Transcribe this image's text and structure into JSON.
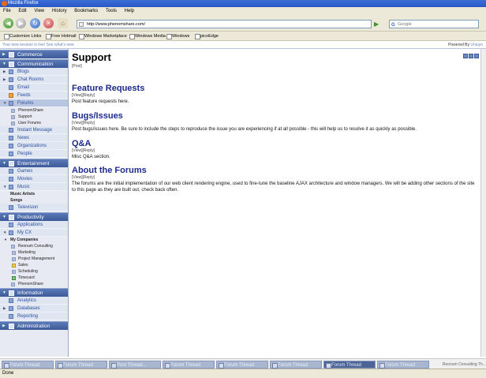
{
  "window": {
    "title": "Mozilla Firefox"
  },
  "menu": [
    "File",
    "Edit",
    "View",
    "History",
    "Bookmarks",
    "Tools",
    "Help"
  ],
  "nav": {
    "url": "http://www.phenomshare.com/",
    "search_placeholder": "Google"
  },
  "bookmarks": [
    "Customize Links",
    "Free Hotmail",
    "Windows Marketplace",
    "Windows Media",
    "Windows",
    "picoEdge"
  ],
  "infostrip": {
    "left": "Your new session is live! See what's new",
    "right": "Powered By",
    "right_logo": "Uniuyo"
  },
  "sidebar": {
    "commerce": "Commerce",
    "communication": "Communication",
    "comm_items": [
      "Blogs",
      "Chat Rooms",
      "Email",
      "Feeds",
      "Forums"
    ],
    "forum_subs": [
      "PhenomShare",
      "Support",
      "User Forums"
    ],
    "comm_items2": [
      "Instant Message",
      "News",
      "Organizations",
      "People"
    ],
    "entertainment": "Entertainment",
    "ent_items": [
      "Games",
      "Movies",
      "Music"
    ],
    "music_subs": [
      "Music Artists",
      "Songs"
    ],
    "television": "Television",
    "productivity": "Productivity",
    "prod_items": [
      "Applications",
      "My CX"
    ],
    "mycompanies": "My Companies",
    "company": "Reonum Consulting",
    "company_subs": [
      "Marketing",
      "Project Management",
      "Sales",
      "Scheduling",
      "Timecard"
    ],
    "phenom": "PhenomShare",
    "information": "Information",
    "info_items": [
      "Analytics",
      "Databases",
      "Reporting"
    ],
    "administration": "Administration"
  },
  "main": {
    "title": "Support",
    "post_link": "[Post]",
    "forums": [
      {
        "title": "Feature Requests",
        "actions": "[View][Reply]",
        "desc": "Post feature requests here."
      },
      {
        "title": "Bugs/Issues",
        "actions": "[View][Reply]",
        "desc": "Post bugs/issues here. Be sure to include the steps to reproduce the issue you are experiencing if at all possible - this will help us to resolve it as quickly as possible."
      },
      {
        "title": "Q&A",
        "actions": "[View][Reply]",
        "desc": "Misc Q&A section."
      },
      {
        "title": "About the Forums",
        "actions": "[View][Reply]",
        "desc": "The forums are the initial implementation of our web client rendering engine, used to fine-tune the baseline AJAX architecture and window managers. We will be adding other sections of the site to this page as they are built out, check back often."
      }
    ]
  },
  "taskbar": {
    "items": [
      "Forum Thread",
      "Forum Thread",
      "Post Thread...",
      "Forum Thread",
      "Forum Thread",
      "Forum Thread",
      "Forum Thread",
      "Forum Thread"
    ],
    "right": "Reonum Consulting Th..."
  },
  "status": "Done"
}
